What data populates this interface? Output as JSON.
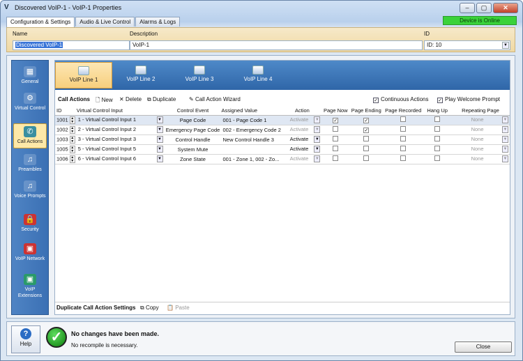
{
  "window": {
    "title": "Discovered VoIP-1 - VoIP-1 Properties",
    "min": "–",
    "max": "▢",
    "close": "✕"
  },
  "tabs": [
    "Configuration & Settings",
    "Audio & Live Control",
    "Alarms & Logs"
  ],
  "status_badge": "Device is Online",
  "fields": {
    "name_label": "Name",
    "name_value": "Discovered VoIP-1",
    "desc_label": "Description",
    "desc_value": "VoIP-1",
    "id_label": "ID",
    "id_value": "ID: 10"
  },
  "sidebar": [
    {
      "label": "General",
      "icon": "▦"
    },
    {
      "label": "Virtual Control",
      "icon": "⚙"
    },
    {
      "label": "Call Actions",
      "icon": "✆"
    },
    {
      "label": "Preambles",
      "icon": "♫"
    },
    {
      "label": "Voice Prompts",
      "icon": "♫"
    },
    {
      "label": "Security",
      "icon": "🔒"
    },
    {
      "label": "VoIP Network",
      "icon": "▣"
    },
    {
      "label": "VoIP Extensions",
      "icon": "▣"
    }
  ],
  "voip_lines": [
    "VoIP Line 1",
    "VoIP Line 2",
    "VoIP Line 3",
    "VoIP Line 4"
  ],
  "actions_bar": {
    "title": "Call Actions",
    "new": "New",
    "delete": "Delete",
    "duplicate": "Duplicate",
    "wizard": "Call Action Wizard",
    "continuous": "Continuous Actions",
    "welcome": "Play Welcome Prompt"
  },
  "table": {
    "headers": [
      "ID",
      "Virtual Control Input",
      "Control Event",
      "Assigned Value",
      "Action",
      "Page Now",
      "Page Ending",
      "Page Recorded",
      "Hang Up",
      "Repeating Page"
    ],
    "rows": [
      {
        "id": "1001",
        "input": "1 - Virtual Control Input 1",
        "event": "Page Code",
        "value": "001 - Page Code 1",
        "action": "Activate",
        "page_now": true,
        "page_ending": true,
        "repeat": "None"
      },
      {
        "id": "1002",
        "input": "2 - Virtual Control Input 2",
        "event": "Emergency Page Code",
        "value": "002 - Emergency Code 2",
        "action": "Activate",
        "page_now": false,
        "page_ending": true,
        "repeat": "None"
      },
      {
        "id": "1003",
        "input": "3 - Virtual Control Input 3",
        "event": "Control Handle",
        "value": "New Control Handle 3",
        "action": "Activate",
        "page_now": false,
        "page_ending": false,
        "repeat": "None"
      },
      {
        "id": "1005",
        "input": "5 - Virtual Control Input 5",
        "event": "System Mute",
        "value": "",
        "action": "Activate",
        "page_now": false,
        "page_ending": false,
        "repeat": "None"
      },
      {
        "id": "1006",
        "input": "6 - Virtual Control Input 6",
        "event": "Zone State",
        "value": "001 - Zone 1, 002 - Zo...",
        "action": "Activate",
        "page_now": false,
        "page_ending": false,
        "repeat": "None"
      }
    ]
  },
  "dup_bar": {
    "title": "Duplicate Call Action Settings",
    "copy": "Copy",
    "paste": "Paste"
  },
  "bottom": {
    "help": "Help",
    "msg1": "No changes have been made.",
    "msg2": "No recompile is necessary.",
    "close": "Close"
  }
}
